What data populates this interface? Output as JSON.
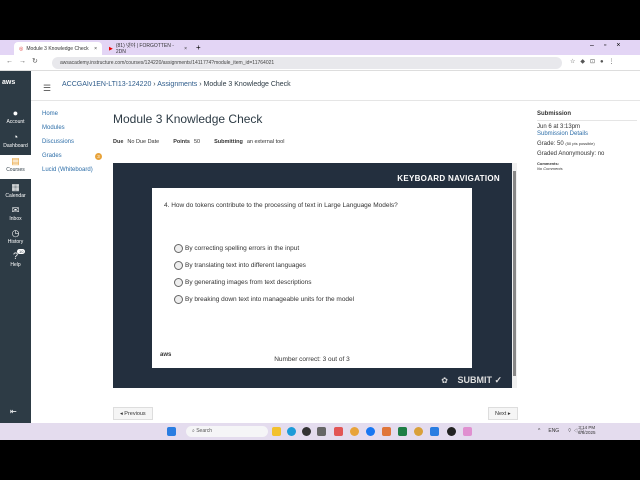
{
  "browser": {
    "tabs": [
      {
        "label": "Module 3 Knowledge Check"
      },
      {
        "label": "(81) 넷야 | FORGOTTEN - 2DN"
      }
    ],
    "url": "awsacademy.instructure.com/courses/124220/assignments/1411774?module_item_id=11764021"
  },
  "global_nav": {
    "logo": "aws",
    "items": [
      {
        "label": "Account",
        "icon": "account-icon"
      },
      {
        "label": "Dashboard",
        "icon": "dashboard-icon"
      },
      {
        "label": "Courses",
        "icon": "courses-icon"
      },
      {
        "label": "Calendar",
        "icon": "calendar-icon"
      },
      {
        "label": "Inbox",
        "icon": "inbox-icon"
      },
      {
        "label": "History",
        "icon": "history-icon"
      },
      {
        "label": "Help",
        "icon": "help-icon",
        "badge": "10"
      }
    ]
  },
  "breadcrumb": {
    "course": "ACCGAIv1EN-LTI13-124220",
    "section": "Assignments",
    "page": "Module 3 Knowledge Check"
  },
  "course_nav": [
    {
      "label": "Home"
    },
    {
      "label": "Modules"
    },
    {
      "label": "Discussions"
    },
    {
      "label": "Grades",
      "badge": "3"
    },
    {
      "label": "Lucid (Whiteboard)"
    }
  ],
  "assignment": {
    "title": "Module 3 Knowledge Check",
    "due_label": "Due",
    "due": "No Due Date",
    "points_label": "Points",
    "points": "50",
    "submitting_label": "Submitting",
    "submitting": "an external tool"
  },
  "tool": {
    "header": "KEYBOARD NAVIGATION",
    "question": "4.  How do tokens contribute to the processing of text in Large Language Models?",
    "options": [
      "By correcting spelling errors in the input",
      "By translating text into different languages",
      "By generating images from text descriptions",
      "By breaking down text into manageable units for the model"
    ],
    "aws_logo": "aws",
    "score": "Number correct: 3 out of 3",
    "submit": "SUBMIT ✓"
  },
  "pager": {
    "previous": "◂ Previous",
    "next": "Next ▸"
  },
  "submission": {
    "heading": "Submission",
    "date": "Jun 6 at 3:13pm",
    "details_link": "Submission Details",
    "grade": "Grade: 50",
    "possible": "(50 pts possible)",
    "anon": "Graded Anonymously: no",
    "comments_label": "Comments:",
    "comments": "No Comments"
  },
  "taskbar": {
    "search": "Search",
    "time": "3:14 PM",
    "date": "6/6/2025",
    "lang": "ENG"
  }
}
